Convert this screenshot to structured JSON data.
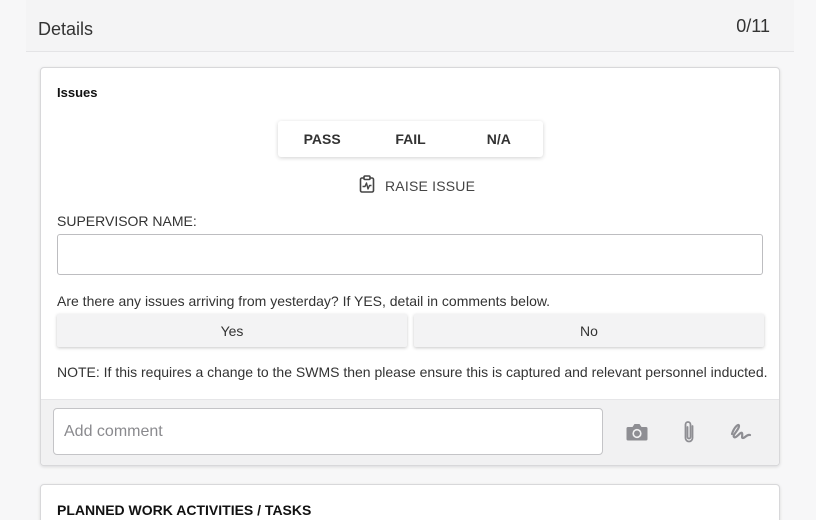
{
  "header": {
    "title": "Details",
    "count": "0/11"
  },
  "issues_card": {
    "title": "Issues",
    "options": [
      "PASS",
      "FAIL",
      "N/A"
    ],
    "raise_issue_label": "RAISE ISSUE",
    "supervisor_label": "SUPERVISOR NAME:",
    "supervisor_value": "",
    "question": "Are there any issues arriving from yesterday? If YES, detail in comments below.",
    "yes_label": "Yes",
    "no_label": "No",
    "note": "NOTE: If this requires a change to the SWMS then please ensure this is captured and relevant personnel inducted.",
    "comment_placeholder": "Add comment"
  },
  "icons": {
    "raise_issue": "clipboard-pulse-icon",
    "camera": "camera-icon",
    "attach": "paperclip-icon",
    "signature": "signature-icon",
    "icon_color": "#8e8e93"
  },
  "planned_card": {
    "title": "PLANNED WORK ACTIVITIES / TASKS"
  }
}
